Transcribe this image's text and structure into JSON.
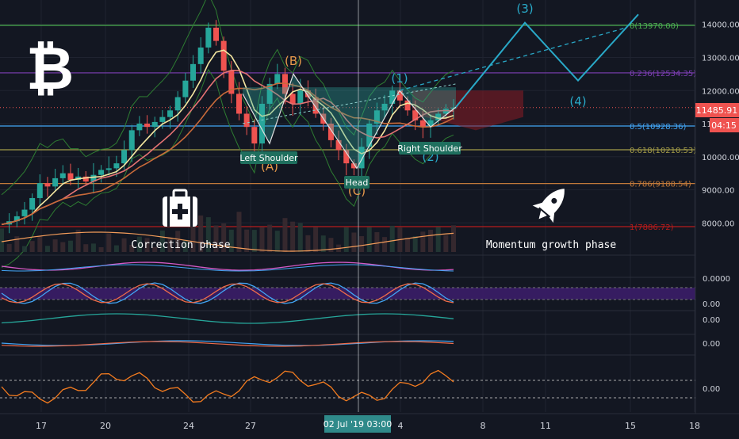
{
  "colors": {
    "background": "#131722",
    "grid": "#1f2330",
    "axis_text": "#d1d4dc",
    "up": "#26a69a",
    "down": "#ef5350",
    "wave": "#29a9c8",
    "fib_0": "#4caf50",
    "fib_236": "#7e3fb5",
    "fib_05": "#42a5f5",
    "fib_618": "#a39b48",
    "fib_786": "#c0793a",
    "fib_1": "#b71c1c",
    "price_marker": "#ef5350",
    "pattern_fill": "#2fa9a0",
    "abc_label": "#e89a4b",
    "osc_band": "#3b1d68"
  },
  "icons": {
    "logo": "bitcoin-icon",
    "correction": "first-aid-kit-icon",
    "momentum": "rocket-icon"
  },
  "chart_data": {
    "type": "candlestick",
    "title": "",
    "price_axis": {
      "min": 7700,
      "max": 14300,
      "ticks": [
        14000,
        13000,
        12000,
        11000,
        10000,
        9000,
        8000
      ],
      "tick_labels": [
        "14000.00",
        "13000.00",
        "12000.00",
        "11",
        "10000.00",
        "9000.00",
        "8000.00"
      ]
    },
    "time_axis": {
      "tick_labels": [
        "17",
        "20",
        "24",
        "27",
        "4",
        "8",
        "11",
        "15",
        "18"
      ],
      "crosshair_label": "02 Jul '19   03:00"
    },
    "last_price": {
      "value": 11485.91,
      "label": "11485.91",
      "countdown": "04:15"
    },
    "fib_levels": [
      {
        "ratio": "0",
        "price": 13970.0,
        "label": "0(13970.00)"
      },
      {
        "ratio": "0.236",
        "price": 12534.35,
        "label": "0.236(12534.35)"
      },
      {
        "ratio": "0.5",
        "price": 10928.36,
        "label": "0.5(10928.36)"
      },
      {
        "ratio": "0.618",
        "price": 10210.53,
        "label": "0.618(10210.53)"
      },
      {
        "ratio": "0.786",
        "price": 9188.54,
        "label": "0.786(9188.54)"
      },
      {
        "ratio": "1",
        "price": 7886.72,
        "label": "1(7886.72)"
      }
    ],
    "pattern_labels": {
      "left_shoulder": "Left Shoulder",
      "head": "Head",
      "right_shoulder": "Right Shoulder"
    },
    "abc_labels": {
      "A": "(A)",
      "B": "(B)",
      "C": "(C)"
    },
    "wave_labels": {
      "w1": "(1)",
      "w2": "(2)",
      "w3": "(3)",
      "w4": "(4)"
    },
    "annotations": {
      "correction": "Correction phase",
      "momentum": "Momentum growth phase"
    },
    "oscillators": [
      {
        "name": "rsi-panel",
        "tick": ""
      },
      {
        "name": "stoch-panel",
        "ticks": [
          "0.0000",
          "0.00"
        ]
      },
      {
        "name": "momentum-panel",
        "ticks": [
          "0.00"
        ]
      },
      {
        "name": "macd-panel",
        "ticks": [
          "0.00"
        ]
      },
      {
        "name": "cci-panel",
        "ticks": [
          "0.00"
        ]
      }
    ],
    "close_series": [
      7950,
      8050,
      8200,
      8400,
      8750,
      9200,
      9100,
      9350,
      9500,
      9300,
      9400,
      9250,
      9450,
      9600,
      9650,
      9800,
      10200,
      10800,
      11000,
      10900,
      11050,
      11200,
      11400,
      11800,
      12300,
      12800,
      13300,
      13900,
      13500,
      12600,
      11900,
      11300,
      10900,
      10400,
      11600,
      12200,
      12500,
      11900,
      11600,
      12000,
      11800,
      11300,
      11000,
      10500,
      10200,
      9800,
      9650,
      10300,
      11000,
      11400,
      11600,
      12000,
      11700,
      11400,
      11100,
      10900,
      11100,
      11300,
      11450,
      11486
    ]
  }
}
